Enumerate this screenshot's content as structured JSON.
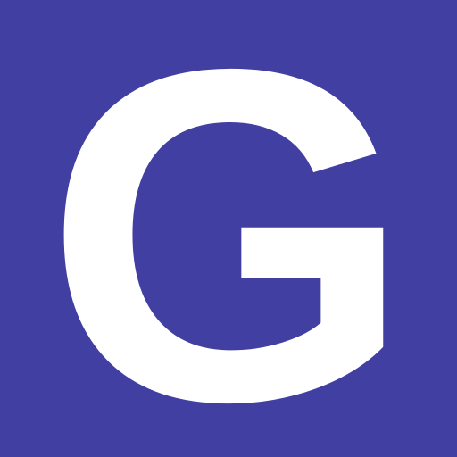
{
  "icon": {
    "letter": "G",
    "background_color": "#413fa1",
    "letter_color": "#ffffff"
  }
}
